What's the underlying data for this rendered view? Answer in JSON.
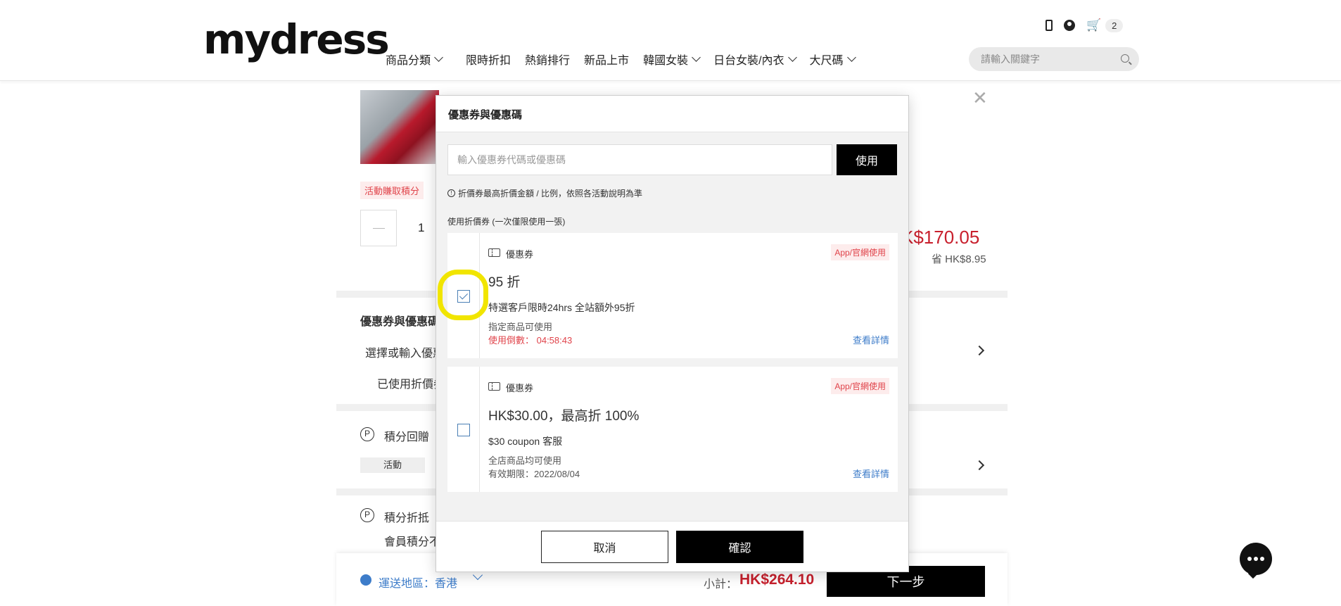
{
  "header": {
    "logo": "mydress",
    "nav": [
      {
        "label": "商品分類",
        "has_dropdown": true
      },
      {
        "label": "限時折扣",
        "has_dropdown": false
      },
      {
        "label": "熱銷排行",
        "has_dropdown": false
      },
      {
        "label": "新品上市",
        "has_dropdown": false
      },
      {
        "label": "韓國女裝",
        "has_dropdown": true
      },
      {
        "label": "日台女裝/內衣",
        "has_dropdown": true
      },
      {
        "label": "大尺碼",
        "has_dropdown": true
      }
    ],
    "cart_count": "2",
    "search_placeholder": "請輸入關鍵字"
  },
  "background": {
    "product_badge": "活動賺取積分",
    "quantity": "1",
    "price": "K$170.05",
    "saving": "省 HK$8.95",
    "coupon_section_title": "優惠券與優惠碼",
    "coupon_section_select": "選擇或輸入優惠",
    "coupon_section_used": "已使用折價券",
    "points_reward_title": "積分回贈",
    "points_reward_tag": "活動",
    "points_offset_title": "積分折抵",
    "points_offset_sub": "會員積分不"
  },
  "footer": {
    "region_label": "運送地區：香港",
    "subtotal_label": "小計：",
    "subtotal_value": "HK$264.10",
    "next_label": "下一步"
  },
  "modal": {
    "title": "優惠券與優惠碼",
    "code_placeholder": "輸入優惠券代碼或優惠碼",
    "apply_label": "使用",
    "note": "折價券最高折價金額 / 比例，依照各活動說明為準",
    "section_label": "使用折價券 (一次僅限使用一張)",
    "coupons": [
      {
        "type": "優惠券",
        "badge": "App/官網使用",
        "title": "95 折",
        "desc": "特選客戶限時24hrs 全站額外95折",
        "scope": "指定商品可使用",
        "time_label": "使用倒數： 04:58:43",
        "detail_label": "查看詳情",
        "checked": true
      },
      {
        "type": "優惠券",
        "badge": "App/官網使用",
        "title": "HK$30.00，最高折 100%",
        "desc": "$30 coupon 客服",
        "scope": "全店商品均可使用",
        "expiry_label": "有效期限：2022/08/04",
        "detail_label": "查看詳情",
        "checked": false
      }
    ],
    "cancel_label": "取消",
    "confirm_label": "確認"
  },
  "colors": {
    "accent_red": "#c8202d",
    "link_blue": "#3d7cc9",
    "highlight_yellow": "#f1e500"
  }
}
